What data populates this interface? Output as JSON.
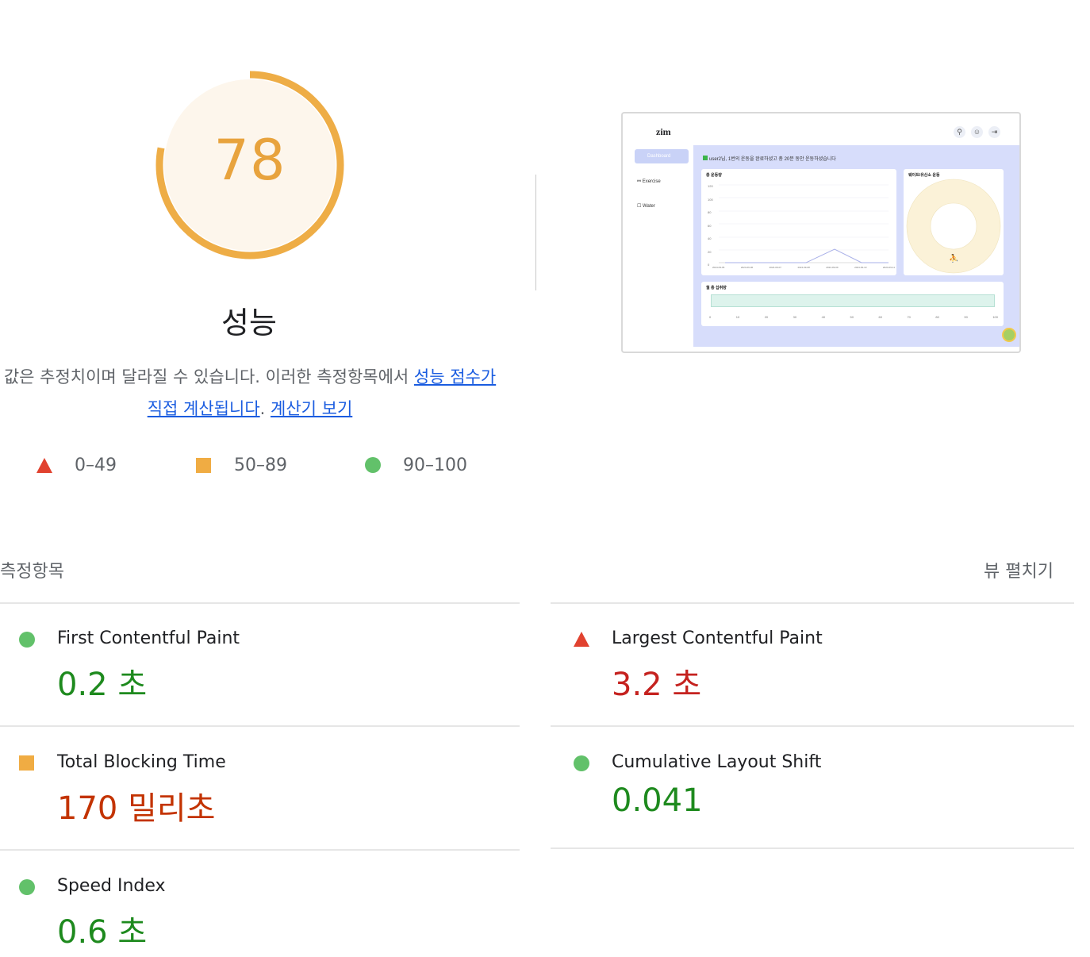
{
  "score": {
    "value": "78",
    "fraction": 0.78,
    "title": "성능",
    "color": "#e8a33d"
  },
  "description": {
    "text": "값은 추정치이며 달라질 수 있습니다. 이러한 측정항목에서 ",
    "link1": "성능 점수가 직접 계산됩니다",
    "sep": ". ",
    "link2": "계산기 보기"
  },
  "legend": {
    "fail": "0–49",
    "average": "50–89",
    "pass": "90–100"
  },
  "thumbnail": {
    "logo": "zim",
    "sidebar": [
      "Dashboard",
      "Exercise",
      "Water"
    ],
    "message": "user2님, 1번의 운동을 완료하셨고 총 20분 동안 운동하셨습니다",
    "chart1_title": "총 운동량",
    "chart1_yticks": [
      "120",
      "100",
      "80",
      "60",
      "40",
      "20",
      "0"
    ],
    "chart1_xticks": [
      "2024-09-05",
      "2024-09-06",
      "2024-09-07",
      "2024-09-08",
      "2024-09-09",
      "2024-09-10",
      "2024-09-11"
    ],
    "chart2_title": "웨이트/유산소 운동",
    "chart3_title": "월 총 섭취량",
    "chart3_xticks": [
      "0",
      "10",
      "20",
      "30",
      "40",
      "50",
      "60",
      "70",
      "80",
      "90",
      "100"
    ]
  },
  "metrics_header": {
    "label": "측정항목",
    "expand": "뷰 펼치기"
  },
  "metrics": {
    "fcp": {
      "title": "First Contentful Paint",
      "value": "0.2 초",
      "status": "pass"
    },
    "lcp": {
      "title": "Largest Contentful Paint",
      "value": "3.2 초",
      "status": "fail"
    },
    "tbt": {
      "title": "Total Blocking Time",
      "value": "170 밀리초",
      "status": "average"
    },
    "cls": {
      "title": "Cumulative Layout Shift",
      "value": "0.041",
      "status": "pass"
    },
    "si": {
      "title": "Speed Index",
      "value": "0.6 초",
      "status": "pass"
    }
  }
}
